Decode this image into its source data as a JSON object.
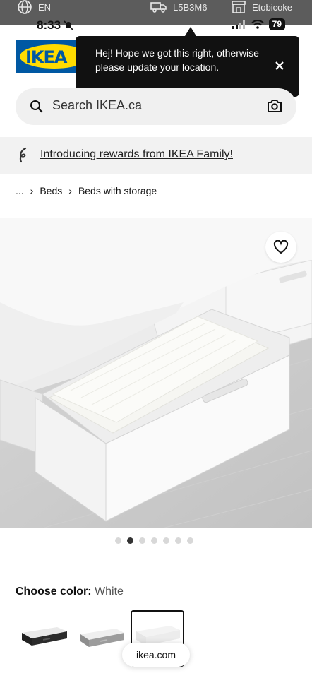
{
  "utility_bar": {
    "language": "EN",
    "postal_code": "L5B3M6",
    "store": "Etobicoke"
  },
  "status_bar": {
    "time": "8:33",
    "battery": "79"
  },
  "logo": {
    "text": "IKEA",
    "brand_blue": "#0058a3",
    "brand_yellow": "#ffdb00"
  },
  "tooltip": {
    "message": "Hej! Hope we got this right, otherwise please update your location."
  },
  "search": {
    "placeholder": "Search IKEA.ca"
  },
  "promo": {
    "text": "Introducing rewards from IKEA Family!"
  },
  "breadcrumb": {
    "ellipsis": "...",
    "items": [
      "Beds",
      "Beds with storage"
    ]
  },
  "carousel": {
    "count": 7,
    "active_index": 1
  },
  "color_picker": {
    "label": "Choose color:",
    "value": "White",
    "selected_index": 2,
    "swatches": [
      "black",
      "grey",
      "white"
    ]
  },
  "browser": {
    "url": "ikea.com"
  }
}
